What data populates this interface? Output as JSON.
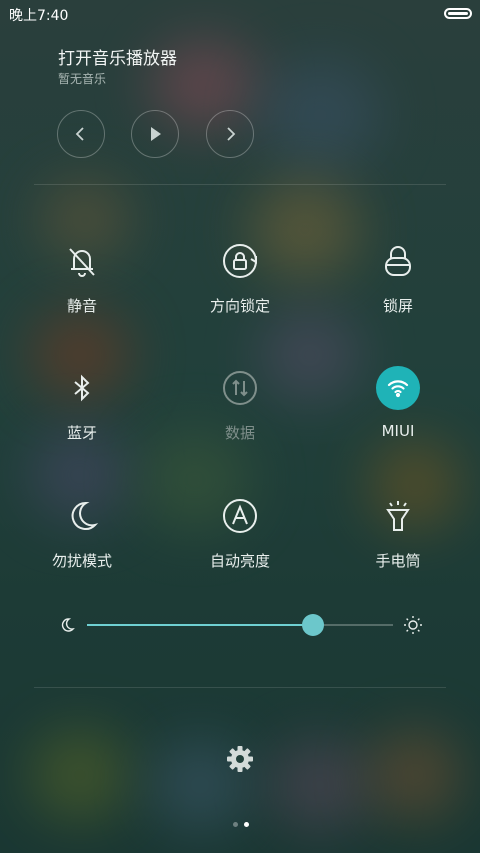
{
  "status_bar": {
    "time": "晚上7:40",
    "battery_icon": "battery-full-icon"
  },
  "music": {
    "title": "打开音乐播放器",
    "subtitle": "暂无音乐",
    "controls": [
      "previous-icon",
      "play-icon",
      "next-icon"
    ]
  },
  "toggles": [
    {
      "label": "静音",
      "icon": "silent-bell-icon",
      "active": false
    },
    {
      "label": "方向锁定",
      "icon": "rotation-lock-icon",
      "active": false
    },
    {
      "label": "锁屏",
      "icon": "lock-icon",
      "active": false
    },
    {
      "label": "蓝牙",
      "icon": "bluetooth-icon",
      "active": false
    },
    {
      "label": "数据",
      "icon": "mobile-data-icon",
      "active": false,
      "disabled": true
    },
    {
      "label": "MIUI",
      "icon": "wifi-icon",
      "active": true
    },
    {
      "label": "勿扰模式",
      "icon": "moon-icon",
      "active": false
    },
    {
      "label": "自动亮度",
      "icon": "auto-brightness-icon",
      "active": false
    },
    {
      "label": "手电筒",
      "icon": "flashlight-icon",
      "active": false
    }
  ],
  "brightness": {
    "level": 0.74,
    "min_icon": "moon-icon",
    "max_icon": "sun-icon"
  },
  "settings": {
    "icon": "gear-icon"
  },
  "pager": {
    "count": 2,
    "current": 1
  },
  "colors": {
    "accent": "#1fb3b7",
    "slider": "#6fd0d2"
  }
}
